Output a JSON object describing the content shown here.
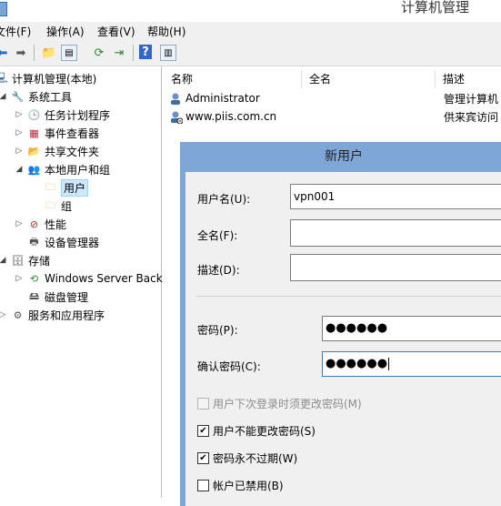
{
  "window": {
    "title": "计算机管理"
  },
  "menu": [
    {
      "label": "文件(F)"
    },
    {
      "label": "操作(A)"
    },
    {
      "label": "查看(V)"
    },
    {
      "label": "帮助(H)"
    }
  ],
  "toolbar": {
    "buttons": [
      "back-icon",
      "forward-icon",
      "up-folder-icon",
      "show-tree-icon",
      "refresh-icon",
      "export-icon",
      "help-icon",
      "properties-icon"
    ]
  },
  "tree": {
    "root": "计算机管理(本地)",
    "system_tools": "系统工具",
    "task_scheduler": "任务计划程序",
    "event_viewer": "事件查看器",
    "shared_folders": "共享文件夹",
    "local_users_groups": "本地用户和组",
    "users": "用户",
    "groups": "组",
    "performance": "性能",
    "device_manager": "设备管理器",
    "storage": "存储",
    "windows_server_backup": "Windows Server Back",
    "disk_management": "磁盘管理",
    "services_apps": "服务和应用程序"
  },
  "list": {
    "columns": [
      "名称",
      "全名",
      "描述"
    ],
    "rows": [
      {
        "name": "Administrator",
        "fullname": "",
        "desc": "管理计算机"
      },
      {
        "name": "www.piis.com.cn",
        "fullname": "",
        "desc": "供来宾访问"
      }
    ]
  },
  "dialog": {
    "title": "新用户",
    "username_label": "用户名(U):",
    "username_value": "vpn001",
    "fullname_label": "全名(F):",
    "fullname_value": "",
    "description_label": "描述(D):",
    "description_value": "",
    "password_label": "密码(P):",
    "password_value": "●●●●●●",
    "confirm_label": "确认密码(C):",
    "confirm_value": "●●●●●●",
    "cb_must_change": {
      "label": "用户下次登录时须更改密码(M)",
      "checked": false,
      "enabled": false
    },
    "cb_cannot_change": {
      "label": "用户不能更改密码(S)",
      "checked": true,
      "enabled": true
    },
    "cb_never_expires": {
      "label": "密码永不过期(W)",
      "checked": true,
      "enabled": true
    },
    "cb_disabled": {
      "label": "帐户已禁用(B)",
      "checked": false,
      "enabled": true
    }
  }
}
